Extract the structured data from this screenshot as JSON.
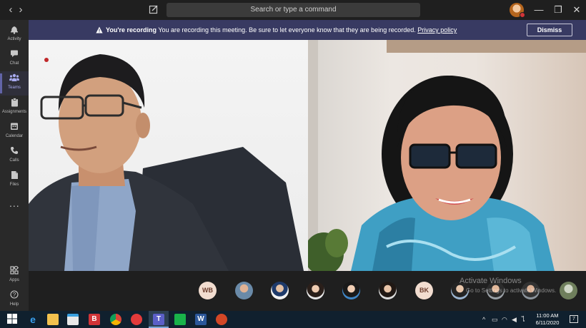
{
  "titlebar": {
    "search_placeholder": "Search or type a command",
    "back_icon": "chevron-left-icon",
    "forward_icon": "chevron-right-icon"
  },
  "rail": {
    "items": [
      {
        "label": "Activity",
        "icon": "bell-icon"
      },
      {
        "label": "Chat",
        "icon": "chat-icon"
      },
      {
        "label": "Teams",
        "icon": "teams-icon",
        "active": true
      },
      {
        "label": "Assignments",
        "icon": "assignments-icon"
      },
      {
        "label": "Calendar",
        "icon": "calendar-icon"
      },
      {
        "label": "Calls",
        "icon": "phone-icon"
      },
      {
        "label": "Files",
        "icon": "files-icon"
      },
      {
        "label": "...",
        "icon": "more-icon"
      }
    ],
    "bottom_items": [
      {
        "label": "Apps",
        "icon": "apps-icon"
      },
      {
        "label": "Help",
        "icon": "help-icon"
      }
    ]
  },
  "banner": {
    "title": "You're recording",
    "message": "You are recording this meeting. Be sure to let everyone know that they are being recorded.",
    "link": "Privacy policy",
    "dismiss": "Dismiss"
  },
  "participants": [
    {
      "type": "initials",
      "text": "WB"
    },
    {
      "type": "photo"
    },
    {
      "type": "photo"
    },
    {
      "type": "photo"
    },
    {
      "type": "photo"
    },
    {
      "type": "photo"
    },
    {
      "type": "initials",
      "text": "BK"
    },
    {
      "type": "photo"
    },
    {
      "type": "photo"
    },
    {
      "type": "photo"
    },
    {
      "type": "photo"
    },
    {
      "type": "photo"
    }
  ],
  "watermark": {
    "line1": "Activate Windows",
    "line2": "Go to Settings to activate Windows."
  },
  "taskbar": {
    "time": "11:00 AM",
    "date": "6/11/2020",
    "notification_count": "7"
  },
  "colors": {
    "banner_bg": "#383a62",
    "accent": "#6264a7",
    "taskbar_bg": "#10202e"
  }
}
